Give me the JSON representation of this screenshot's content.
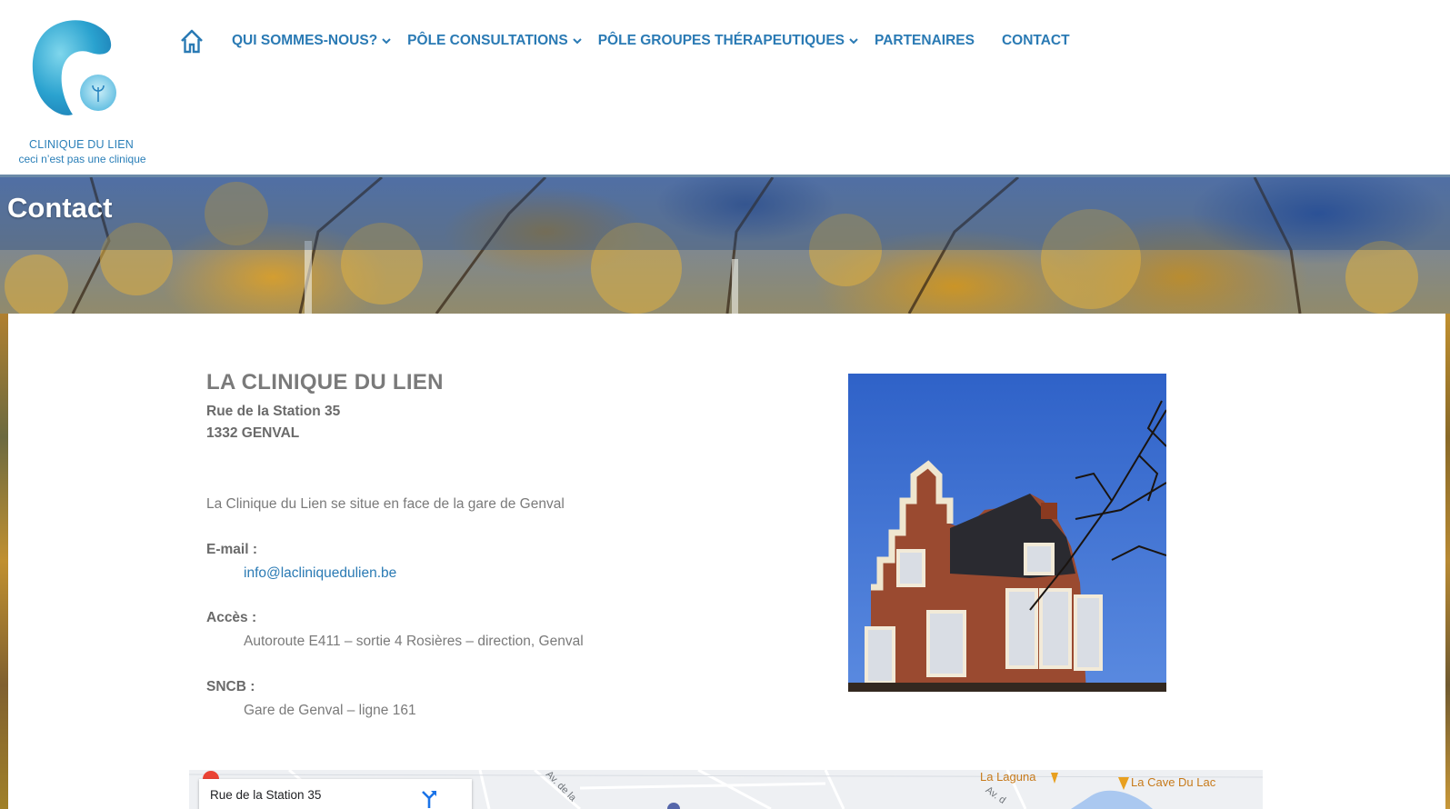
{
  "logo": {
    "name": "CLINIQUE DU LIEN",
    "tagline": "ceci n’est pas une clinique"
  },
  "nav": {
    "home_icon": "home-icon",
    "items": [
      {
        "label": "QUI SOMMES-NOUS?",
        "has_dropdown": true
      },
      {
        "label": "PÔLE CONSULTATIONS",
        "has_dropdown": true
      },
      {
        "label": "PÔLE GROUPES THÉRAPEUTIQUES",
        "has_dropdown": true
      },
      {
        "label": "PARTENAIRES",
        "has_dropdown": false
      },
      {
        "label": "CONTACT",
        "has_dropdown": false
      }
    ]
  },
  "page": {
    "title": "Contact"
  },
  "contact": {
    "org_name": "LA CLINIQUE DU LIEN",
    "street": "Rue de la Station 35",
    "city": "1332 GENVAL",
    "description": "La Clinique du Lien se situe en face de la gare de Genval",
    "email_label": "E-mail :",
    "email": "info@lacliniquedulien.be",
    "access_label": "Accès :",
    "access_value": "Autoroute E411 –  sortie 4 Rosières – direction, Genval",
    "sncb_label": "SNCB :",
    "sncb_value": "Gare de Genval – ligne 161"
  },
  "map": {
    "card_title": "Rue de la Station 35",
    "place_labels": [
      "La Laguna",
      "La Cave Du Lac"
    ],
    "street_labels": [
      "Av. de la",
      "Av. d"
    ]
  },
  "colors": {
    "nav_blue": "#2a7ab4",
    "text_gray": "#7a7a7a",
    "header_line": "#6b8aa8"
  }
}
